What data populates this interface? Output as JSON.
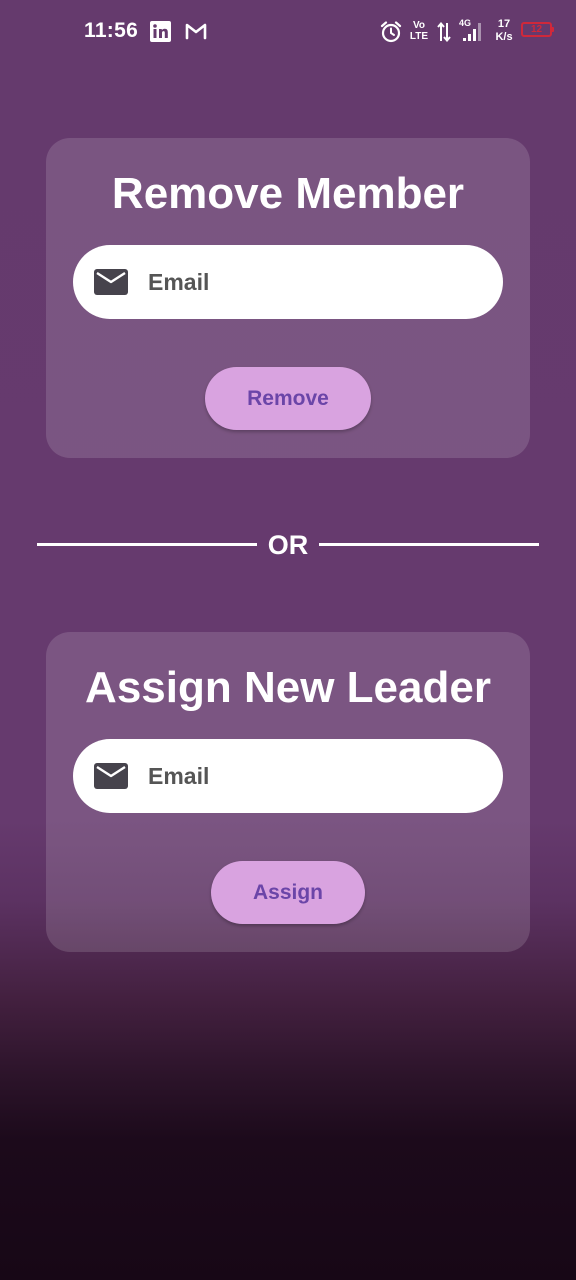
{
  "status_bar": {
    "time": "11:56",
    "volte_line1": "Vo",
    "volte_line2": "LTE",
    "network_type": "4G",
    "speed_value": "17",
    "speed_unit": "K/s",
    "battery_level": "12",
    "icons": [
      "linkedin-icon",
      "gmail-icon",
      "alarm-icon",
      "volte-icon",
      "data-arrows-icon",
      "signal-icon",
      "battery-icon"
    ]
  },
  "remove_card": {
    "title": "Remove Member",
    "email_placeholder": "Email",
    "email_value": "",
    "button_label": "Remove"
  },
  "divider": {
    "label": "OR"
  },
  "assign_card": {
    "title": "Assign New Leader",
    "email_placeholder": "Email",
    "email_value": "",
    "button_label": "Assign"
  },
  "colors": {
    "background": "#653a6d",
    "card": "rgba(255,255,255,0.14)",
    "button": "#d9a3e0",
    "button_text": "#6b45a8",
    "battery_low": "#d0283a"
  }
}
